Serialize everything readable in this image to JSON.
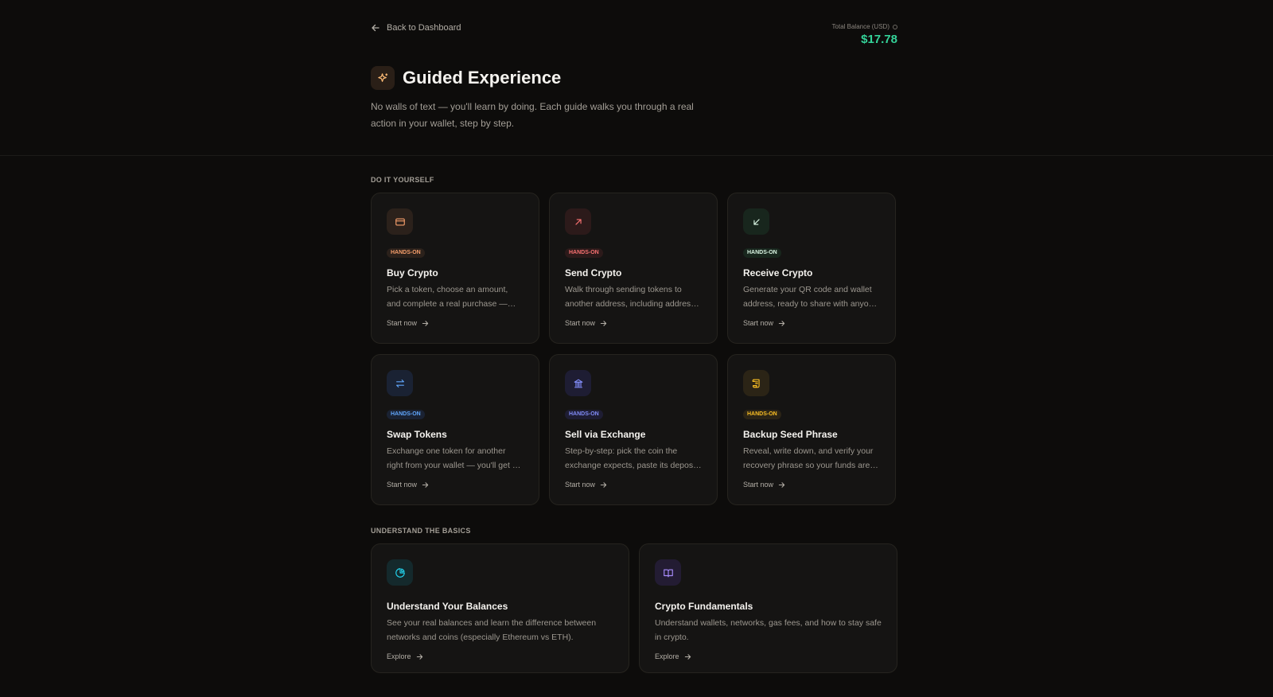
{
  "nav": {
    "back_label": "Back to Dashboard"
  },
  "balance": {
    "label": "Total Balance (USD)",
    "value": "$17.78"
  },
  "page": {
    "title": "Guided Experience",
    "subtitle": "No walls of text — you'll learn by doing. Each guide walks you through a real action in your wallet, step by step."
  },
  "sections": {
    "diy_label": "DO IT YOURSELF",
    "basics_label": "UNDERSTAND THE BASICS"
  },
  "guides": [
    {
      "badge": "HANDS-ON",
      "title": "Buy Crypto",
      "desc": "Pick a token, choose an amount, and complete a real purchase — with clear steps along the way.",
      "cta": "Start now",
      "icon": "credit-card-icon",
      "color": "#f59e6b",
      "bg": "#2b211b"
    },
    {
      "badge": "HANDS-ON",
      "title": "Send Crypto",
      "desc": "Walk through sending tokens to another address, including address checks and network fees.",
      "cta": "Start now",
      "icon": "arrow-up-right-icon",
      "color": "#f87171",
      "bg": "#2c1a1a"
    },
    {
      "badge": "HANDS-ON",
      "title": "Receive Crypto",
      "desc": "Generate your QR code and wallet address, ready to share with anyone sending you funds.",
      "cta": "Start now",
      "icon": "arrow-down-left-icon",
      "color": "#d9f5e3",
      "bg": "#18261d"
    },
    {
      "badge": "HANDS-ON",
      "title": "Swap Tokens",
      "desc": "Exchange one token for another right from your wallet — you'll get a quote before confirming.",
      "cta": "Start now",
      "icon": "swap-arrows-icon",
      "color": "#60a5fa",
      "bg": "#1a2233"
    },
    {
      "badge": "HANDS-ON",
      "title": "Sell via Exchange",
      "desc": "Step-by-step: pick the coin the exchange expects, paste its deposit address, and send.",
      "cta": "Start now",
      "icon": "bank-icon",
      "color": "#818cf8",
      "bg": "#1e1d33"
    },
    {
      "badge": "HANDS-ON",
      "title": "Backup Seed Phrase",
      "desc": "Reveal, write down, and verify your recovery phrase so your funds are always safe.",
      "cta": "Start now",
      "icon": "scroll-icon",
      "color": "#fbbf24",
      "bg": "#2b2416"
    }
  ],
  "basics": [
    {
      "title": "Understand Your Balances",
      "desc": "See your real balances and learn the difference between networks and coins (especially Ethereum vs ETH).",
      "cta": "Explore",
      "icon": "pie-chart-icon",
      "color": "#22d3ee",
      "bg": "#14292c"
    },
    {
      "title": "Crypto Fundamentals",
      "desc": "Understand wallets, networks, gas fees, and how to stay safe in crypto.",
      "cta": "Explore",
      "icon": "book-icon",
      "color": "#a78bfa",
      "bg": "#231c33"
    }
  ],
  "colors": {
    "accent_green": "#34d399",
    "background": "#0d0c0b",
    "card": "#151413"
  }
}
